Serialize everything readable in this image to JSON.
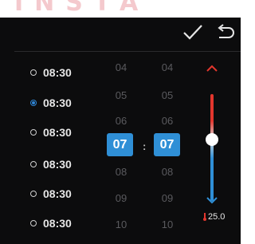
{
  "header": {
    "confirm_icon": "checkmark-icon",
    "back_icon": "return-arrow-icon"
  },
  "alarms": [
    {
      "time": "08:30",
      "selected": false
    },
    {
      "time": "08:30",
      "selected": true
    },
    {
      "time": "08:30",
      "selected": false
    },
    {
      "time": "08:30",
      "selected": false
    },
    {
      "time": "08:30",
      "selected": false
    },
    {
      "time": "08:30",
      "selected": false
    }
  ],
  "picker": {
    "hours": {
      "above": [
        "04",
        "05",
        "06"
      ],
      "selected": "07",
      "below": [
        "08",
        "09",
        "10"
      ]
    },
    "minutes": {
      "above": [
        "04",
        "05",
        "06"
      ],
      "selected": "07",
      "below": [
        "08",
        "09",
        "10"
      ]
    },
    "separator": ":"
  },
  "temperature": {
    "value": "25.0",
    "level": 0.35,
    "colors": {
      "hot": "#e3362d",
      "cold": "#2f8fd6"
    }
  },
  "colors": {
    "background": "#0c0c0d",
    "accent": "#2f8fd6"
  }
}
